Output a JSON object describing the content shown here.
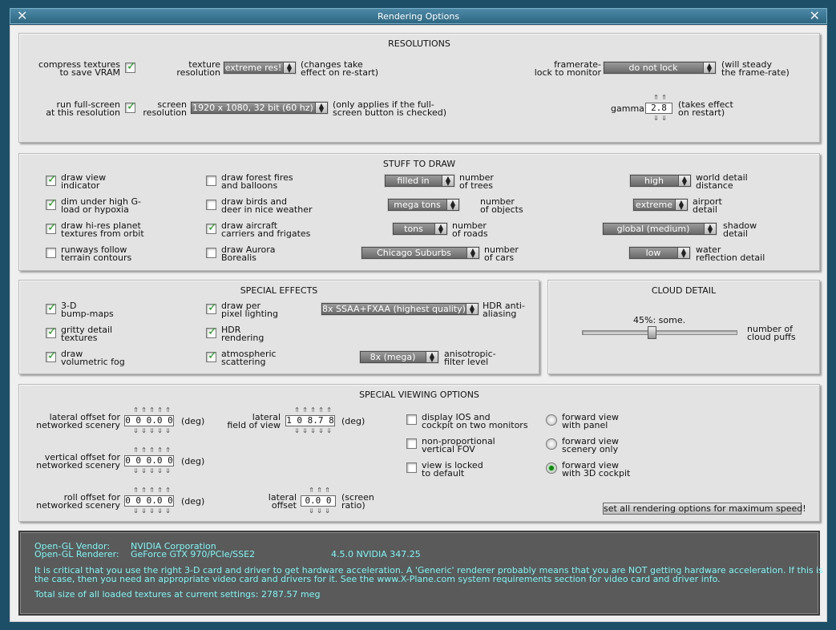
{
  "window": {
    "title": "Rendering Options"
  },
  "resolutions": {
    "title": "RESOLUTIONS",
    "compress": {
      "l1": "compress textures",
      "l2": "to save VRAM",
      "checked": true
    },
    "texres": {
      "l1": "texture",
      "l2": "resolution",
      "value": "extreme res!",
      "note1": "(changes take",
      "note2": "effect on re-start)"
    },
    "framerate": {
      "l1": "framerate-",
      "l2": "lock to monitor",
      "value": "do not lock",
      "note1": "(will steady",
      "note2": "the frame-rate)"
    },
    "fullscreen": {
      "l1": "run full-screen",
      "l2": "at this resolution",
      "checked": true
    },
    "screenres": {
      "l1": "screen",
      "l2": "resolution",
      "value": "1920 x 1080, 32 bit (60 hz)",
      "note1": "(only applies if the full-",
      "note2": "screen button is checked)"
    },
    "gamma": {
      "label": "gamma",
      "value": "2.8",
      "note1": "(takes effect",
      "note2": "on restart)"
    }
  },
  "stuff": {
    "title": "STUFF TO DRAW",
    "checks": [
      {
        "l1": "draw view",
        "l2": "indicator",
        "checked": true
      },
      {
        "l1": "dim under high G-",
        "l2": "load or hypoxia",
        "checked": true
      },
      {
        "l1": "draw hi-res planet",
        "l2": "textures from orbit",
        "checked": true
      },
      {
        "l1": "runways follow",
        "l2": "terrain contours",
        "checked": false
      },
      {
        "l1": "draw forest fires",
        "l2": "and balloons",
        "checked": false
      },
      {
        "l1": "draw birds and",
        "l2": "deer in nice weather",
        "checked": false
      },
      {
        "l1": "draw aircraft",
        "l2": "carriers and frigates",
        "checked": true
      },
      {
        "l1": "draw Aurora",
        "l2": "Borealis",
        "checked": false
      }
    ],
    "dropdowns": [
      {
        "value": "filled in",
        "l1": "number",
        "l2": "of trees"
      },
      {
        "value": "mega tons",
        "l1": "number",
        "l2": "of objects"
      },
      {
        "value": "tons",
        "l1": "number",
        "l2": "of roads"
      },
      {
        "value": "Chicago Suburbs",
        "l1": "number",
        "l2": "of cars"
      },
      {
        "value": "high",
        "l1": "world detail",
        "l2": "distance"
      },
      {
        "value": "extreme",
        "l1": "airport",
        "l2": "detail"
      },
      {
        "value": "global (medium)",
        "l1": "shadow",
        "l2": "detail"
      },
      {
        "value": "low",
        "l1": "water",
        "l2": "reflection detail"
      }
    ]
  },
  "effects": {
    "title": "SPECIAL EFFECTS",
    "checks": [
      {
        "l1": "3-D",
        "l2": "bump-maps",
        "checked": true
      },
      {
        "l1": "gritty detail",
        "l2": "textures",
        "checked": true
      },
      {
        "l1": "draw",
        "l2": "volumetric fog",
        "checked": true
      },
      {
        "l1": "draw per",
        "l2": "pixel lighting",
        "checked": true
      },
      {
        "l1": "HDR",
        "l2": "rendering",
        "checked": true
      },
      {
        "l1": "atmospheric",
        "l2": "scattering",
        "checked": true
      }
    ],
    "hdr": {
      "value": "8x SSAA+FXAA (highest quality)",
      "l1": "HDR anti-",
      "l2": "aliasing"
    },
    "aniso": {
      "value": "8x (mega)",
      "l1": "anisotropic-",
      "l2": "filter level"
    }
  },
  "cloud": {
    "title": "CLOUD DETAIL",
    "value_text": "45%: some.",
    "fraction": 0.45,
    "l1": "number of",
    "l2": "cloud puffs"
  },
  "viewing": {
    "title": "SPECIAL VIEWING OPTIONS",
    "lateral_net": {
      "l1": "lateral offset for",
      "l2": "networked scenery",
      "value": "0 0 0.0 0",
      "unit": "(deg)"
    },
    "vertical_net": {
      "l1": "vertical offset for",
      "l2": "networked scenery",
      "value": "0 0 0.0 0",
      "unit": "(deg)"
    },
    "roll_net": {
      "l1": "roll offset for",
      "l2": "networked scenery",
      "value": "0 0 0.0 0",
      "unit": "(deg)"
    },
    "fov": {
      "l1": "lateral",
      "l2": "field of view",
      "value": "1 0 8.7 8",
      "unit": "(deg)"
    },
    "lat_offset": {
      "l1": "lateral",
      "l2": "offset",
      "value": "0.0 0",
      "u1": "(screen",
      "u2": "ratio)"
    },
    "checks": [
      {
        "l1": "display IOS and",
        "l2": "cockpit on two monitors",
        "checked": false
      },
      {
        "l1": "non-proportional",
        "l2": "vertical FOV",
        "checked": false
      },
      {
        "l1": "view is locked",
        "l2": "to default",
        "checked": false
      }
    ],
    "radios": [
      {
        "l1": "forward view",
        "l2": "with panel",
        "selected": false
      },
      {
        "l1": "forward view",
        "l2": "scenery only",
        "selected": false
      },
      {
        "l1": "forward view",
        "l2": "with 3D cockpit",
        "selected": true
      }
    ],
    "max_speed_button": "set all rendering options for maximum speed!"
  },
  "info": {
    "vendor_label": "Open-GL Vendor:",
    "vendor": "NVIDIA Corporation",
    "renderer_label": "Open-GL Renderer:",
    "renderer": "GeForce GTX 970/PCIe/SSE2",
    "version": "4.5.0 NVIDIA 347.25",
    "warn1": "It is critical that you use the right 3-D card and driver to get hardware acceleration. A 'Generic' renderer probably means that you are NOT getting hardware acceleration. If this is",
    "warn2": "the case, then you need an appropriate video card and drivers for it. See the www.X-Plane.com system requirements section for video card and driver info.",
    "total": "Total size of all loaded textures at current settings: 2787.57 meg"
  },
  "colors": {
    "check": "#1b9a1b",
    "info_text": "#7ff5f5",
    "frame": "#1e4f69"
  }
}
